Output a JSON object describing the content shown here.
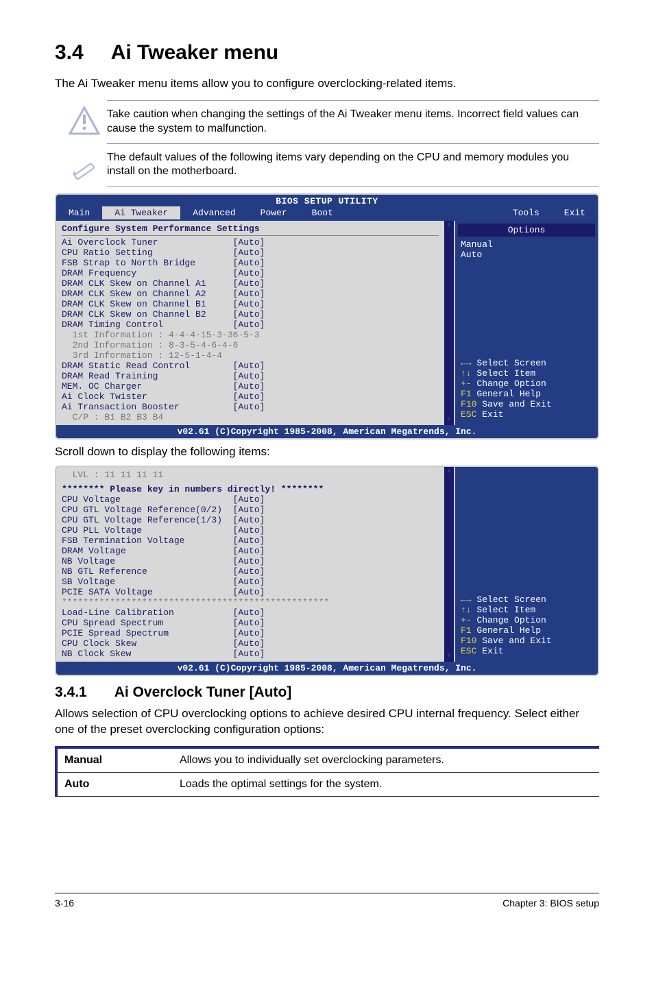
{
  "section": {
    "number": "3.4",
    "title": "Ai Tweaker menu"
  },
  "intro": "The Ai Tweaker menu items allow you to configure overclocking-related items.",
  "note1": "Take caution when changing the settings of the Ai Tweaker menu items. Incorrect field values can cause the system to malfunction.",
  "note2": "The default values of the following items vary depending on the CPU and memory modules you install on the motherboard.",
  "bios": {
    "title": "BIOS SETUP UTILITY",
    "tabs": [
      "Main",
      "Ai Tweaker",
      "Advanced",
      "Power",
      "Boot",
      "Tools",
      "Exit"
    ],
    "config_head": "Configure System Performance Settings",
    "rows1": [
      {
        "l": "Ai Overclock Tuner",
        "v": "[Auto]",
        "c": "blue"
      },
      {
        "l": "CPU Ratio Setting",
        "v": "[Auto]",
        "c": "blue"
      },
      {
        "l": "FSB Strap to North Bridge",
        "v": "[Auto]",
        "c": "blue"
      },
      {
        "l": "DRAM Frequency",
        "v": "[Auto]",
        "c": "blue"
      },
      {
        "l": "DRAM CLK Skew on Channel A1",
        "v": "[Auto]",
        "c": "blue"
      },
      {
        "l": "DRAM CLK Skew on Channel A2",
        "v": "[Auto]",
        "c": "blue"
      },
      {
        "l": "DRAM CLK Skew on Channel B1",
        "v": "[Auto]",
        "c": "blue"
      },
      {
        "l": "DRAM CLK Skew on Channel B2",
        "v": "[Auto]",
        "c": "blue"
      },
      {
        "l": "DRAM Timing Control",
        "v": "[Auto]",
        "c": "blue"
      },
      {
        "l": "  1st Information : 4-4-4-15-3-36-5-3",
        "v": "",
        "c": "gray"
      },
      {
        "l": "  2nd Information : 8-3-5-4-6-4-6",
        "v": "",
        "c": "gray"
      },
      {
        "l": "  3rd Information : 12-5-1-4-4",
        "v": "",
        "c": "gray"
      },
      {
        "l": "DRAM Static Read Control",
        "v": "[Auto]",
        "c": "blue"
      },
      {
        "l": "DRAM Read Training",
        "v": "[Auto]",
        "c": "blue"
      },
      {
        "l": "MEM. OC Charger",
        "v": "[Auto]",
        "c": "blue"
      },
      {
        "l": "Ai Clock Twister",
        "v": "[Auto]",
        "c": "blue"
      },
      {
        "l": "Ai Transaction Booster",
        "v": "[Auto]",
        "c": "blue"
      },
      {
        "l": "  C/P : B1 B2 B3 B4",
        "v": "",
        "c": "gray"
      }
    ],
    "options_head": "Options",
    "options": [
      "Manual",
      "Auto"
    ],
    "legend": [
      {
        "k": "←→",
        "d": "Select Screen"
      },
      {
        "k": "↑↓",
        "d": "Select Item"
      },
      {
        "k": "+-",
        "d": "Change Option"
      },
      {
        "k": "F1",
        "d": "General Help"
      },
      {
        "k": "F10",
        "d": "Save and Exit"
      },
      {
        "k": "ESC",
        "d": "Exit"
      }
    ],
    "foot": "v02.61 (C)Copyright 1985-2008, American Megatrends, Inc."
  },
  "scroll_note": "Scroll down to display the following items:",
  "bios2": {
    "lvl": "  LVL : 11 11 11 11",
    "banner": "******** Please key in numbers directly! ********",
    "rows": [
      {
        "l": "CPU Voltage",
        "v": "[Auto]"
      },
      {
        "l": "CPU GTL Voltage Reference(0/2)",
        "v": "[Auto]"
      },
      {
        "l": "CPU GTL Voltage Reference(1/3)",
        "v": "[Auto]"
      },
      {
        "l": "CPU PLL Voltage",
        "v": "[Auto]"
      },
      {
        "l": "FSB Termination Voltage",
        "v": "[Auto]"
      },
      {
        "l": "DRAM Voltage",
        "v": "[Auto]"
      },
      {
        "l": "NB Voltage",
        "v": "[Auto]"
      },
      {
        "l": "NB GTL Reference",
        "v": "[Auto]"
      },
      {
        "l": "SB Voltage",
        "v": "[Auto]"
      },
      {
        "l": "PCIE SATA Voltage",
        "v": "[Auto]"
      }
    ],
    "stars": "**************************************************",
    "rows2": [
      {
        "l": "Load-Line Calibration",
        "v": "[Auto]"
      },
      {
        "l": "CPU Spread Spectrum",
        "v": "[Auto]"
      },
      {
        "l": "PCIE Spread Spectrum",
        "v": "[Auto]"
      },
      {
        "l": "CPU Clock Skew",
        "v": "[Auto]"
      },
      {
        "l": "NB Clock Skew",
        "v": "[Auto]"
      }
    ]
  },
  "subsec": {
    "number": "3.4.1",
    "title": "Ai Overclock Tuner [Auto]"
  },
  "subsec_body": "Allows selection of CPU overclocking options to achieve desired CPU internal frequency. Select either one of the preset overclocking configuration options:",
  "opt_table": [
    {
      "k": "Manual",
      "d": "Allows you to individually set overclocking parameters."
    },
    {
      "k": "Auto",
      "d": "Loads the optimal settings for the system."
    }
  ],
  "footer": {
    "left": "3-16",
    "right": "Chapter 3: BIOS setup"
  }
}
